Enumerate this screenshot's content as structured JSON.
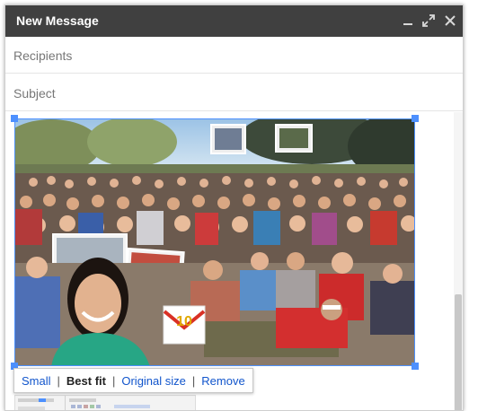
{
  "window": {
    "title": "New Message",
    "icons": {
      "minimize": "minimize-icon",
      "popout": "popout-icon",
      "close": "close-icon"
    }
  },
  "fields": {
    "recipients_placeholder": "Recipients",
    "subject_placeholder": "Subject"
  },
  "image_size_options": {
    "small": "Small",
    "best_fit": "Best fit",
    "original_size": "Original size",
    "remove": "Remove",
    "selected": "Best fit",
    "separator": "|"
  },
  "photo_overlay": {
    "badge_number": "10"
  },
  "colors": {
    "titlebar": "#404040",
    "selection": "#4d90fe",
    "link": "#1155cc"
  }
}
